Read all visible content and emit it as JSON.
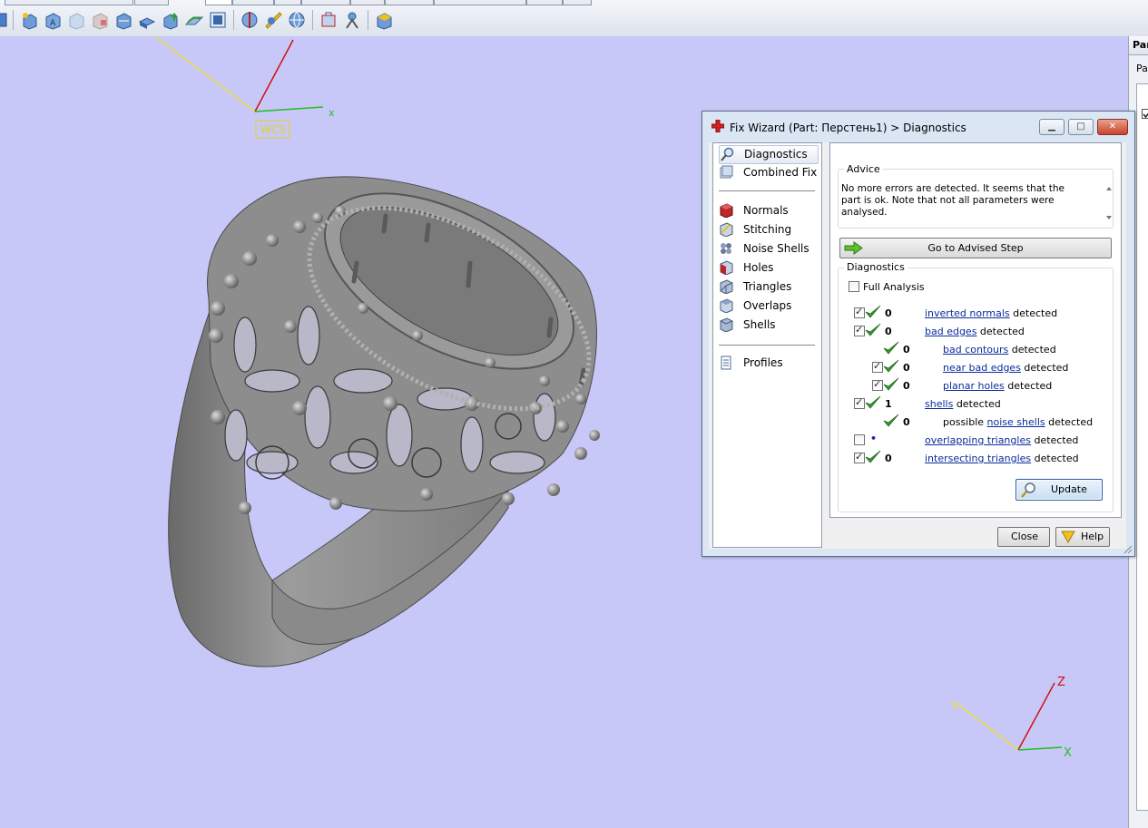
{
  "viewport": {
    "wcs_label": "WCS",
    "axis_x": "x",
    "corner_axes": {
      "x": "X",
      "y": "Y",
      "z": "Z"
    },
    "model": "ring-mesh"
  },
  "right_panel": {
    "title": "Par",
    "subtitle": "Pa"
  },
  "dialog": {
    "title": "Fix Wizard (Part: Перстень1) > Diagnostics",
    "nav": {
      "top": [
        {
          "label": "Diagnostics",
          "icon": "magnifier-icon",
          "selected": true
        },
        {
          "label": "Combined Fix",
          "icon": "combined-fix-icon"
        }
      ],
      "steps": [
        {
          "label": "Normals",
          "icon": "normals-icon"
        },
        {
          "label": "Stitching",
          "icon": "stitching-icon"
        },
        {
          "label": "Noise Shells",
          "icon": "noise-shells-icon"
        },
        {
          "label": "Holes",
          "icon": "holes-icon"
        },
        {
          "label": "Triangles",
          "icon": "triangles-icon"
        },
        {
          "label": "Overlaps",
          "icon": "overlaps-icon"
        },
        {
          "label": "Shells",
          "icon": "shells-icon"
        }
      ],
      "bottom": [
        {
          "label": "Profiles",
          "icon": "profiles-icon"
        }
      ]
    },
    "advice": {
      "group_label": "Advice",
      "text": "No more errors are detected. It seems that the part is ok. Note that not all parameters were analysed.",
      "button": "Go to Advised Step"
    },
    "diagnostics": {
      "group_label": "Diagnostics",
      "full_analysis_label": "Full Analysis",
      "rows": [
        {
          "checked": true,
          "count": "0",
          "link": "inverted normals",
          "suffix": " detected"
        },
        {
          "checked": true,
          "count": "0",
          "link": "bad edges",
          "suffix": " detected"
        },
        {
          "checked": null,
          "count": "0",
          "link": "bad contours",
          "suffix": " detected"
        },
        {
          "checked": true,
          "count": "0",
          "link": "near bad edges",
          "suffix": " detected"
        },
        {
          "checked": true,
          "count": "0",
          "link": "planar holes",
          "suffix": " detected"
        },
        {
          "checked": true,
          "count": "1",
          "link": "shells",
          "suffix": " detected"
        },
        {
          "checked": null,
          "count": "0",
          "prefix": "possible ",
          "link": "noise shells",
          "suffix": " detected"
        },
        {
          "checked": false,
          "count": "",
          "link": "overlapping triangles",
          "suffix": " detected"
        },
        {
          "checked": true,
          "count": "0",
          "link": "intersecting triangles",
          "suffix": " detected"
        }
      ],
      "update_button": "Update"
    },
    "close_button": "Close",
    "help_button": "Help"
  }
}
